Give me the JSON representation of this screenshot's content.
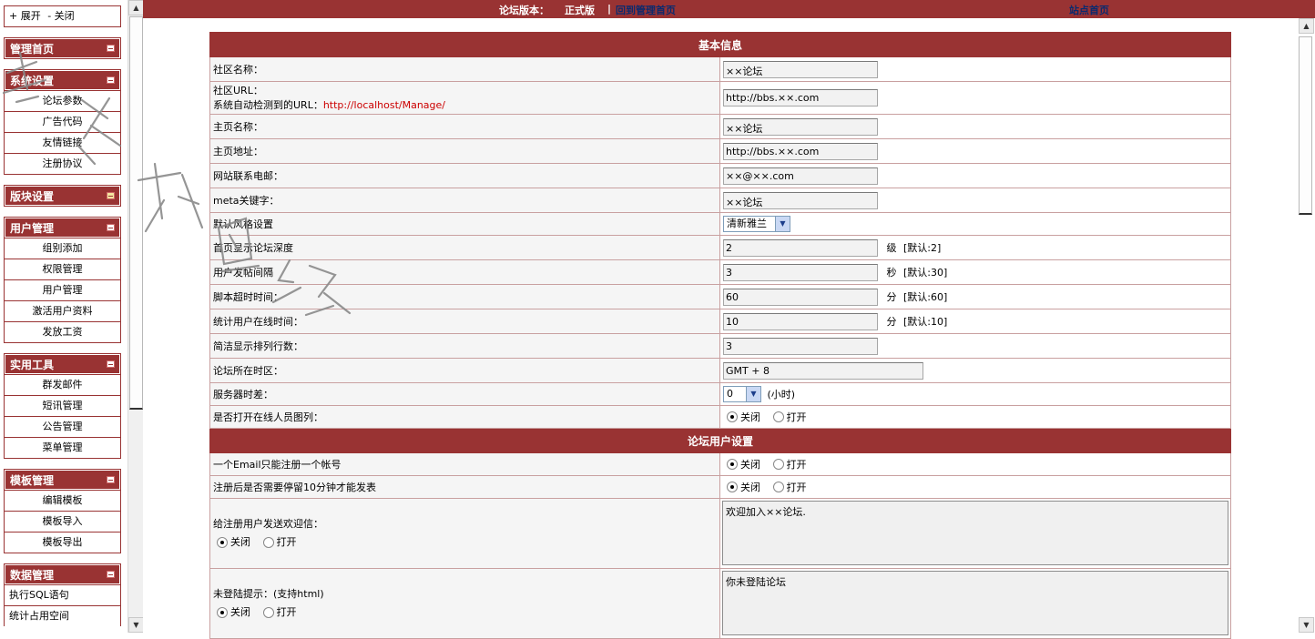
{
  "topbar": {
    "version_label": "论坛版本：",
    "version_value": "正式版",
    "separator": "|",
    "back_link": "回到管理首页",
    "home_link": "站点首页"
  },
  "sidebar": {
    "toggle": {
      "expand": "+ 展开",
      "collapse": "- 关闭"
    },
    "groups": [
      {
        "title": "管理首页",
        "items": []
      },
      {
        "title": "系统设置",
        "items": [
          "论坛参数",
          "广告代码",
          "友情链接",
          "注册协议"
        ]
      },
      {
        "title": "版块设置",
        "items": []
      },
      {
        "title": "用户管理",
        "items": [
          "组别添加",
          "权限管理",
          "用户管理",
          "激活用户资料",
          "发放工资"
        ]
      },
      {
        "title": "实用工具",
        "items": [
          "群发邮件",
          "短讯管理",
          "公告管理",
          "菜单管理"
        ]
      },
      {
        "title": "模板管理",
        "items": [
          "编辑模板",
          "模板导入",
          "模板导出"
        ]
      },
      {
        "title": "数据管理",
        "items": [
          "执行SQL语句",
          "统计占用空间"
        ]
      }
    ]
  },
  "watermark": "老农树网络",
  "form": {
    "section_basic": "基本信息",
    "section_user": "论坛用户设置",
    "site_name": {
      "label": "社区名称：",
      "value": "××论坛"
    },
    "site_url": {
      "label": "社区URL：",
      "detect_label": "系统自动检测到的URL：",
      "detected": "http://localhost/Manage/",
      "value": "http://bbs.××.com"
    },
    "home_name": {
      "label": "主页名称：",
      "value": "××论坛"
    },
    "home_url": {
      "label": "主页地址：",
      "value": "http://bbs.××.com"
    },
    "email": {
      "label": "网站联系电邮：",
      "value": "××@××.com"
    },
    "meta": {
      "label": "meta关键字：",
      "value": "××论坛"
    },
    "style": {
      "label": "默认风格设置",
      "value": "清新雅兰"
    },
    "depth": {
      "label": "首页显示论坛深度",
      "value": "2",
      "unit": "级",
      "default": "[默认:2]"
    },
    "post_interval": {
      "label": "用户发帖间隔",
      "value": "3",
      "unit": "秒",
      "default": "[默认:30]"
    },
    "script_timeout": {
      "label": "脚本超时时间：",
      "value": "60",
      "unit": "分",
      "default": "[默认:60]"
    },
    "online_time": {
      "label": "统计用户在线时间：",
      "value": "10",
      "unit": "分",
      "default": "[默认:10]"
    },
    "rows": {
      "label": "简洁显示排列行数：",
      "value": "3"
    },
    "timezone": {
      "label": "论坛所在时区：",
      "value": "GMT + 8"
    },
    "time_diff": {
      "label": "服务器时差：",
      "value": "0",
      "unit": "(小时)"
    },
    "online_list": {
      "label": "是否打开在线人员图列："
    },
    "one_email": {
      "label": "一个Email只能注册一个帐号"
    },
    "wait10": {
      "label": "注册后是否需要停留10分钟才能发表"
    },
    "welcome": {
      "label": "给注册用户发送欢迎信：",
      "value": "欢迎加入××论坛."
    },
    "guest_tip": {
      "label": "未登陆提示：(支持html)",
      "value": "你未登陆论坛"
    },
    "radio_off": "关闭",
    "radio_on": "打开"
  }
}
